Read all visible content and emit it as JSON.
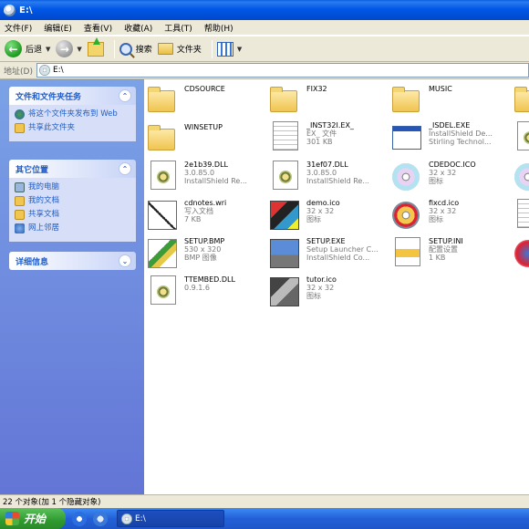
{
  "window": {
    "title": "E:\\"
  },
  "menu": [
    "文件(F)",
    "编辑(E)",
    "查看(V)",
    "收藏(A)",
    "工具(T)",
    "帮助(H)"
  ],
  "toolbar": {
    "back_label": "后退",
    "search_label": "搜索",
    "folders_label": "文件夹"
  },
  "address": {
    "label": "地址(D)",
    "value": "E:\\"
  },
  "left_pane": {
    "file_tasks": {
      "title": "文件和文件夹任务",
      "items": [
        "将这个文件夹发布到 Web",
        "共享此文件夹"
      ]
    },
    "other_places": {
      "title": "其它位置",
      "items": [
        "我的电脑",
        "我的文档",
        "共享文档",
        "网上邻居"
      ]
    },
    "details": {
      "title": "详细信息"
    }
  },
  "files": [
    {
      "name": "CDSOURCE",
      "line2": "",
      "line3": "",
      "kind": "folder"
    },
    {
      "name": "FIX32",
      "line2": "",
      "line3": "",
      "kind": "folder"
    },
    {
      "name": "MUSIC",
      "line2": "",
      "line3": "",
      "kind": "folder"
    },
    {
      "name": "WINSETUP",
      "line2": "",
      "line3": "",
      "kind": "folder"
    },
    {
      "name": "_INST32I.EX_",
      "line2": "EX_ 文件",
      "line3": "301 KB",
      "kind": "doc"
    },
    {
      "name": "_ISDEL.EXE",
      "line2": "InstallShield De...",
      "line3": "Stirling Technol...",
      "kind": "exe"
    },
    {
      "name": "2e1b39.DLL",
      "line2": "3.0.85.0",
      "line3": "InstallShield Re...",
      "kind": "dll"
    },
    {
      "name": "31ef07.DLL",
      "line2": "3.0.85.0",
      "line3": "InstallShield Re...",
      "kind": "dll"
    },
    {
      "name": "CDEDOC.ICO",
      "line2": "32 x 32",
      "line3": "图标",
      "kind": "cd"
    },
    {
      "name": "cdnotes.wri",
      "line2": "写入文档",
      "line3": "7 KB",
      "kind": "wri"
    },
    {
      "name": "demo.ico",
      "line2": "32 x 32",
      "line3": "图标",
      "kind": "pic"
    },
    {
      "name": "fixcd.ico",
      "line2": "32 x 32",
      "line3": "图标",
      "kind": "cd"
    },
    {
      "name": "SETUP.BMP",
      "line2": "530 x 320",
      "line3": "BMP 图像",
      "kind": "paint"
    },
    {
      "name": "SETUP.EXE",
      "line2": "Setup Launcher C...",
      "line3": "InstallShield Co...",
      "kind": "setup"
    },
    {
      "name": "SETUP.INI",
      "line2": "配置设置",
      "line3": "1 KB",
      "kind": "ini"
    },
    {
      "name": "TTEMBED.DLL",
      "line2": "0.9.1.6",
      "line3": "",
      "kind": "dll"
    },
    {
      "name": "tutor.ico",
      "line2": "32 x 32",
      "line3": "图标",
      "kind": "pic"
    }
  ],
  "status": {
    "text": "22 个对象(加 1 个隐藏对象)"
  },
  "taskbar": {
    "start_label": "开始",
    "task_label": "E:\\"
  }
}
